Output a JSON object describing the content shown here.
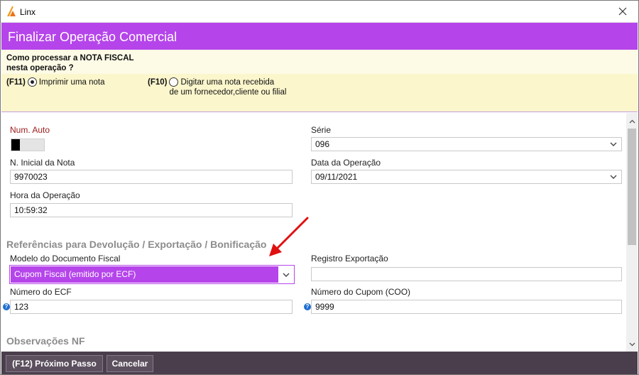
{
  "window": {
    "title": "Linx",
    "close_glyph": "✕"
  },
  "header": {
    "title": "Finalizar Operação Comercial"
  },
  "question": {
    "text_line1": "Como processar a NOTA FISCAL",
    "text_line2": "nesta operação ?",
    "options": [
      {
        "key": "(F11)",
        "label": "Imprimir uma nota",
        "selected": true
      },
      {
        "key": "(F10)",
        "label_line1": "Digitar uma nota recebida",
        "label_line2": "de um fornecedor,cliente ou filial",
        "selected": false
      }
    ]
  },
  "form": {
    "num_auto": {
      "label": "Num. Auto",
      "toggle_on": false
    },
    "serie": {
      "label": "Série",
      "value": "096"
    },
    "n_inicial": {
      "label": "N. Inicial da Nota",
      "value": "9970023"
    },
    "data_operacao": {
      "label": "Data da Operação",
      "value": "09/11/2021"
    },
    "hora_operacao": {
      "label": "Hora da Operação",
      "value": "10:59:32"
    },
    "section_referencias": "Referências para Devolução / Exportação / Bonificação",
    "modelo_documento": {
      "label": "Modelo do Documento Fiscal",
      "value": "Cupom Fiscal (emitido por ECF)"
    },
    "registro_exportacao": {
      "label": "Registro Exportação",
      "value": ""
    },
    "numero_ecf": {
      "label": "Número do ECF",
      "value": "123"
    },
    "numero_cupom": {
      "label": "Número do Cupom (COO)",
      "value": "9999"
    },
    "section_observacoes": "Observações NF"
  },
  "footer": {
    "next_label": "(F12) Próximo Passo",
    "cancel_label": "Cancelar"
  },
  "colors": {
    "accent": "#b545ea",
    "question_bg": "#fbf6cc",
    "footer_bg": "#4a3e4c",
    "annotation_arrow": "#e01010"
  }
}
